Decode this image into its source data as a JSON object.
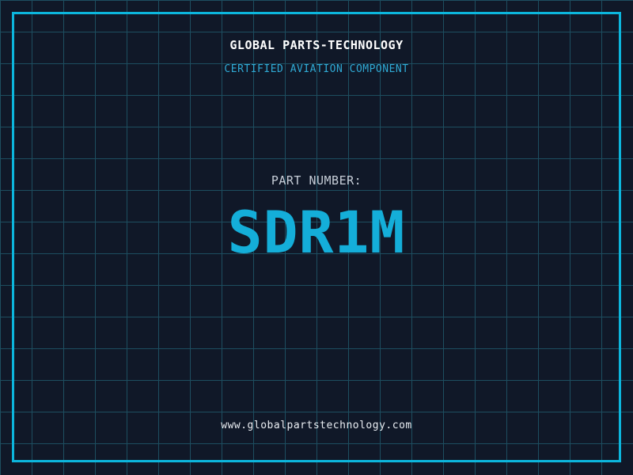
{
  "page": {
    "title": "GLOBAL PARTS-TECHNOLOGY",
    "subtitle": "CERTIFIED AVIATION COMPONENT",
    "part_label": "PART NUMBER:",
    "part_number": "SDR1M",
    "website": "www.globalpartstechnology.com"
  },
  "colors": {
    "background": "#101828",
    "grid_line": "#1d4e60",
    "frame": "#0cb6dd",
    "title": "#ffffff",
    "subtitle": "#2fa9d4",
    "part_label": "#c7ced8",
    "part_number": "#14aed9",
    "website": "#e9edf2"
  }
}
